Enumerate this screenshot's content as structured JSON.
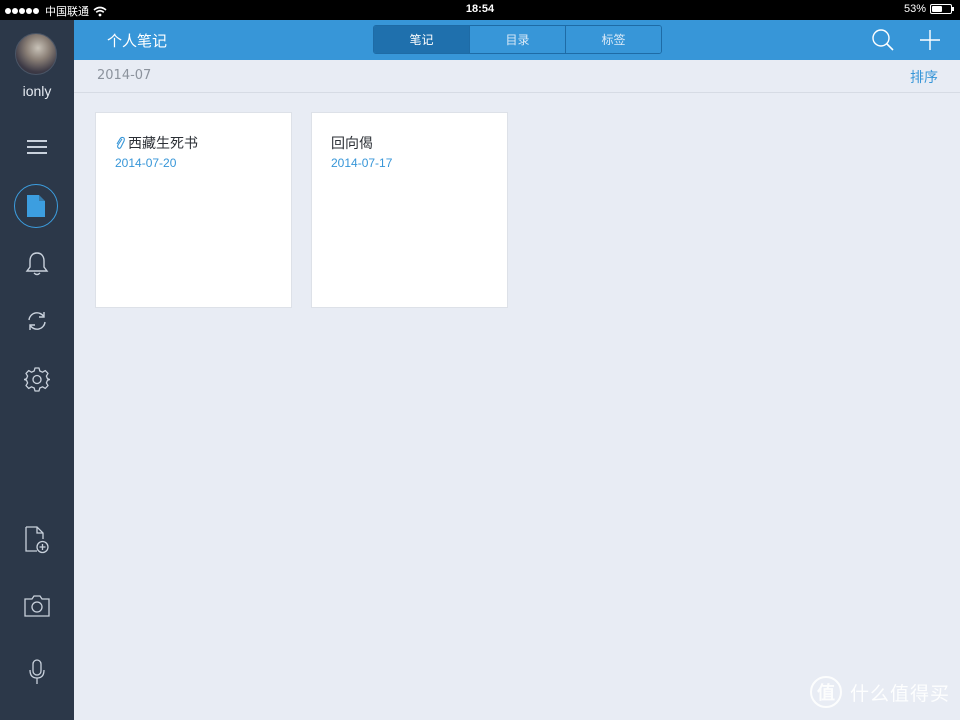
{
  "status_bar": {
    "carrier": "中国联通",
    "time": "18:54",
    "battery": "53%",
    "battery_level": 0.53
  },
  "sidebar": {
    "username": "ionly",
    "items": [
      {
        "name": "menu-icon"
      },
      {
        "name": "notes-icon",
        "active": true
      },
      {
        "name": "bell-icon"
      },
      {
        "name": "sync-icon"
      },
      {
        "name": "gear-icon"
      },
      {
        "name": "new-note-icon"
      },
      {
        "name": "camera-icon"
      },
      {
        "name": "microphone-icon"
      }
    ]
  },
  "navbar": {
    "title": "个人笔记",
    "tabs": [
      {
        "label": "笔记",
        "active": true
      },
      {
        "label": "目录",
        "active": false
      },
      {
        "label": "标签",
        "active": false
      }
    ]
  },
  "subheader": {
    "month": "2014-07",
    "sort_label": "排序"
  },
  "notes": [
    {
      "title": "西藏生死书",
      "date": "2014-07-20",
      "attachment": true
    },
    {
      "title": "回向偈",
      "date": "2014-07-17",
      "attachment": false
    }
  ],
  "watermark": {
    "logo": "值",
    "text": "什么值得买"
  },
  "colors": {
    "accent": "#3796d8",
    "sidebar": "#2c3849",
    "background": "#e8ecf4"
  }
}
